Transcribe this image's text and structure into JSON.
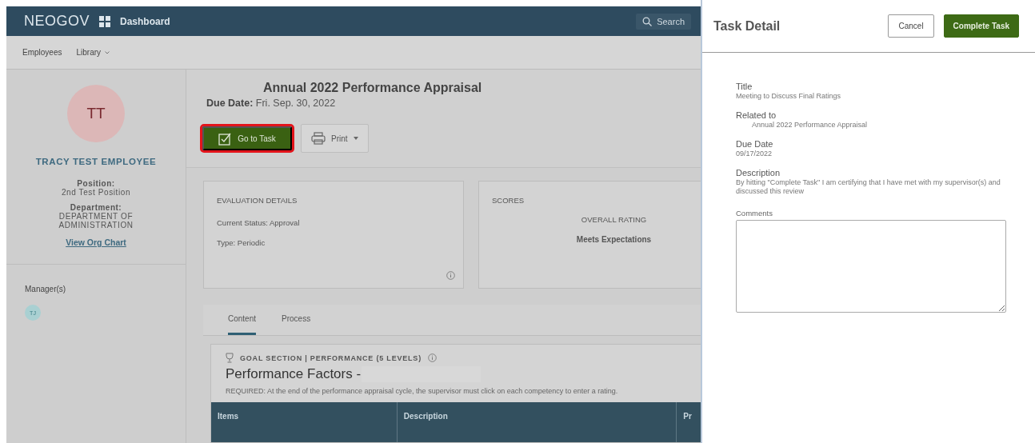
{
  "topbar": {
    "logo": "NEOGOV",
    "nav_label": "Dashboard",
    "search_label": "Search"
  },
  "subnav": [
    {
      "label": "Employees",
      "dropdown": false
    },
    {
      "label": "Library",
      "dropdown": true
    }
  ],
  "employee": {
    "initials": "TT",
    "name": "TRACY TEST EMPLOYEE",
    "fields": [
      {
        "label": "Position:",
        "value": "2nd Test Position"
      },
      {
        "label": "Department:",
        "value": "DEPARTMENT OF ADMINISTRATION"
      }
    ],
    "link": "View Org Chart",
    "managers_label": "Manager(s)",
    "managers": [
      "TJ"
    ]
  },
  "appraisal": {
    "title": "Annual 2022 Performance Appraisal",
    "due_label": "Due Date:",
    "due_value": "Fri. Sep. 30, 2022",
    "buttons": [
      {
        "label": "Go to Task",
        "kind": "primary",
        "highlighted": true
      },
      {
        "label": "Print",
        "kind": "menu",
        "highlighted": false
      }
    ]
  },
  "evaluation": {
    "heading": "EVALUATION DETAILS",
    "rows": [
      {
        "label": "Current Status:",
        "value": "Approval"
      },
      {
        "label": "Type:",
        "value": "Periodic"
      }
    ]
  },
  "scores": {
    "heading": "SCORES",
    "label": "OVERALL RATING",
    "value": "Meets Expectations"
  },
  "tabs": [
    {
      "label": "Content",
      "selected": true
    },
    {
      "label": "Process",
      "selected": false
    }
  ],
  "section": {
    "heading": "GOAL SECTION | PERFORMANCE (5 LEVELS)",
    "title": "Performance Factors -",
    "note": "REQUIRED: At the end of the performance appraisal cycle, the supervisor must click on each competency to enter a rating.",
    "columns": [
      "Items",
      "Description",
      "Pr"
    ]
  },
  "task_panel": {
    "title": "Task Detail",
    "buttons": [
      {
        "label": "Cancel",
        "kind": "secondary"
      },
      {
        "label": "Complete Task",
        "kind": "primary"
      }
    ],
    "fields": [
      {
        "label": "Title",
        "value": "Meeting to Discuss Final Ratings",
        "indented": false
      },
      {
        "label": "Related to",
        "value": "Annual 2022 Performance Appraisal",
        "indented": true
      },
      {
        "label": "Due Date",
        "value": "09/17/2022",
        "indented": false
      },
      {
        "label": "Description",
        "value": "By hitting \"Complete Task\" I am certifying that I have met with my supervisor(s) and discussed this review",
        "indented": false
      }
    ],
    "comments_label": "Comments"
  }
}
